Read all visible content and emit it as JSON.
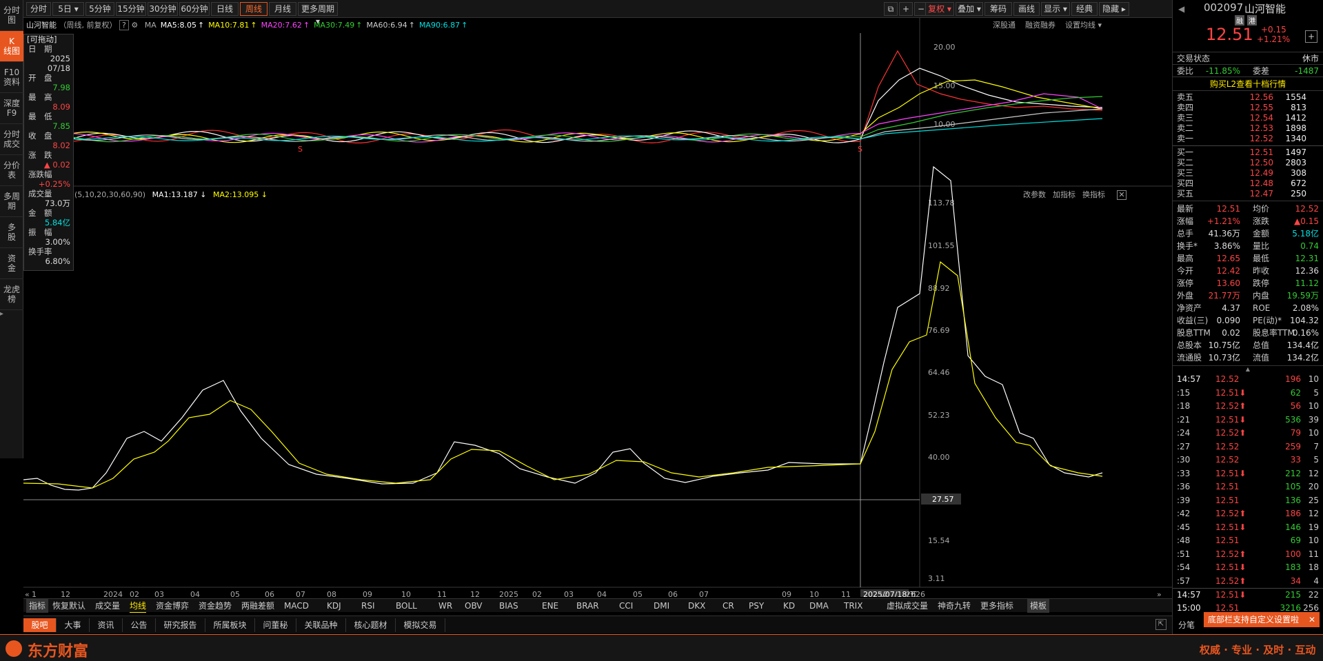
{
  "left_tabs": [
    {
      "l1": "分时",
      "l2": "图"
    },
    {
      "l1": "K",
      "l2": "线图"
    },
    {
      "l1": "F10",
      "l2": "资料"
    },
    {
      "l1": "深度",
      "l2": "F9"
    },
    {
      "l1": "分时",
      "l2": "成交"
    },
    {
      "l1": "分价",
      "l2": "表"
    },
    {
      "l1": "多周",
      "l2": "期"
    },
    {
      "l1": "多",
      "l2": "股"
    },
    {
      "l1": "资",
      "l2": "金"
    },
    {
      "l1": "龙虎",
      "l2": "榜"
    }
  ],
  "top_tabs": [
    "分时",
    "5日 ▾",
    "5分钟",
    "15分钟",
    "30分钟",
    "60分钟",
    "日线",
    "周线",
    "月线",
    "更多周期 ▾"
  ],
  "top_right": [
    "复权 ▾",
    "叠加 ▾",
    "筹码",
    "画线",
    "显示 ▾",
    "经典",
    "隐藏 ▸"
  ],
  "top_icons": [
    "⧉",
    "+",
    "−"
  ],
  "stock": {
    "name": "山河智能",
    "info": "（周线, 前复权）",
    "code": "002097",
    "title_name": "山河智能",
    "tag1": "融",
    "tag2": "港",
    "price": "12.51",
    "chg": "+0.15",
    "pct": "+1.21%"
  },
  "ma_legend": [
    {
      "label": "MA",
      "val": ""
    },
    {
      "label": "MA5:",
      "val": "8.05"
    },
    {
      "label": "MA10:",
      "val": "7.81"
    },
    {
      "label": "MA20:",
      "val": "7.62"
    },
    {
      "label": "MA30:",
      "val": "7.49"
    },
    {
      "label": "MA60:",
      "val": "6.94"
    },
    {
      "label": "MA90:",
      "val": "6.87"
    }
  ],
  "price_right_links": [
    "深股通",
    "融资融券",
    "设置均线 ▾"
  ],
  "price_axis": [
    "20.00",
    "15.00",
    "10.00"
  ],
  "ind_legend": {
    "params": "(5,10,20,30,60,90)",
    "ma1": "MA1:13.187",
    "ma2": "MA2:13.095"
  },
  "ind_links": [
    "改参数",
    "加指标",
    "换指标"
  ],
  "ind_axis": [
    "113.78",
    "101.55",
    "88.92",
    "76.69",
    "64.46",
    "52.23",
    "40.00",
    "27.57",
    "15.54",
    "3.11"
  ],
  "cursor_value": "27.57",
  "x_labels": [
    "12",
    "2024",
    "02",
    "03",
    "04",
    "05",
    "06",
    "07",
    "08",
    "09",
    "10",
    "11",
    "12",
    "2025",
    "02",
    "03",
    "04",
    "05",
    "06",
    "07",
    "2025/07/18/五",
    "09",
    "10",
    "11",
    "12",
    "2026"
  ],
  "x_first": "1",
  "data_panel": {
    "title": "[可拖动]",
    "rows": [
      {
        "k": "日　期",
        "v": "2025",
        "v2": "07/18",
        "cls": "w"
      },
      {
        "k": "开　盘",
        "v": "7.98",
        "cls": "g"
      },
      {
        "k": "最　高",
        "v": "8.09",
        "cls": "r"
      },
      {
        "k": "最　低",
        "v": "7.85",
        "cls": "g"
      },
      {
        "k": "收　盘",
        "v": "8.02",
        "cls": "r"
      },
      {
        "k": "涨　跌",
        "v": "▲ 0.02",
        "cls": "r"
      },
      {
        "k": "涨跌幅",
        "v": "+0.25%",
        "cls": "r"
      },
      {
        "k": "成交量",
        "v": "73.0万",
        "cls": "w"
      },
      {
        "k": "金　额",
        "v": "5.84亿",
        "cls": "c"
      },
      {
        "k": "振　幅",
        "v": "3.00%",
        "cls": "w"
      },
      {
        "k": "换手率",
        "v": "6.80%",
        "cls": "w"
      }
    ]
  },
  "trade_status": {
    "label": "交易状态",
    "value": "休市"
  },
  "weibi": {
    "l1": "委比",
    "v1": "-11.85%",
    "l2": "委差",
    "v2": "-1487"
  },
  "buy_l2": "购买L2查看十档行情",
  "sells": [
    {
      "k": "卖五",
      "p": "12.56",
      "v": "1554"
    },
    {
      "k": "卖四",
      "p": "12.55",
      "v": "813"
    },
    {
      "k": "卖三",
      "p": "12.54",
      "v": "1412"
    },
    {
      "k": "卖二",
      "p": "12.53",
      "v": "1898"
    },
    {
      "k": "卖一",
      "p": "12.52",
      "v": "1340"
    }
  ],
  "buys": [
    {
      "k": "买一",
      "p": "12.51",
      "v": "1497"
    },
    {
      "k": "买二",
      "p": "12.50",
      "v": "2803"
    },
    {
      "k": "买三",
      "p": "12.49",
      "v": "308"
    },
    {
      "k": "买四",
      "p": "12.48",
      "v": "672"
    },
    {
      "k": "买五",
      "p": "12.47",
      "v": "250"
    }
  ],
  "quote": [
    {
      "a": "最新",
      "b": "12.51",
      "bc": "r",
      "c": "均价",
      "d": "12.52",
      "dc": "r"
    },
    {
      "a": "涨幅",
      "b": "+1.21%",
      "bc": "r",
      "c": "涨跌",
      "d": "▲0.15",
      "dc": "r"
    },
    {
      "a": "总手",
      "b": "41.36万",
      "bc": "w",
      "c": "金额",
      "d": "5.18亿",
      "dc": "c"
    },
    {
      "a": "换手*",
      "b": "3.86%",
      "bc": "w",
      "c": "量比",
      "d": "0.74",
      "dc": "g"
    },
    {
      "a": "最高",
      "b": "12.65",
      "bc": "r",
      "c": "最低",
      "d": "12.31",
      "dc": "g"
    },
    {
      "a": "今开",
      "b": "12.42",
      "bc": "r",
      "c": "昨收",
      "d": "12.36",
      "dc": "w"
    },
    {
      "a": "涨停",
      "b": "13.60",
      "bc": "r",
      "c": "跌停",
      "d": "11.12",
      "dc": "g"
    },
    {
      "a": "外盘",
      "b": "21.77万",
      "bc": "r",
      "c": "内盘",
      "d": "19.59万",
      "dc": "g"
    },
    {
      "a": "净资产",
      "b": "4.37",
      "bc": "w",
      "c": "ROE",
      "d": "2.08%",
      "dc": "w"
    },
    {
      "a": "收益(三)",
      "b": "0.090",
      "bc": "w",
      "c": "PE(动)*",
      "d": "104.32",
      "dc": "w"
    },
    {
      "a": "股息TTM",
      "b": "0.02",
      "bc": "w",
      "c": "股息率TTM",
      "d": "0.16%",
      "dc": "w"
    },
    {
      "a": "总股本",
      "b": "10.75亿",
      "bc": "w",
      "c": "总值",
      "d": "134.4亿",
      "dc": "w"
    },
    {
      "a": "流通股",
      "b": "10.73亿",
      "bc": "w",
      "c": "流值",
      "d": "134.2亿",
      "dc": "w"
    }
  ],
  "ticks": [
    {
      "t": "14:57",
      "p": "12.52",
      "pc": "r",
      "v": "196",
      "vc": "r",
      "n": "10"
    },
    {
      "t": ":15",
      "p": "12.51⬇",
      "pc": "r",
      "v": "62",
      "vc": "g",
      "n": "5"
    },
    {
      "t": ":18",
      "p": "12.52⬆",
      "pc": "r",
      "v": "56",
      "vc": "r",
      "n": "10"
    },
    {
      "t": ":21",
      "p": "12.51⬇",
      "pc": "r",
      "v": "536",
      "vc": "g",
      "n": "39"
    },
    {
      "t": ":24",
      "p": "12.52⬆",
      "pc": "r",
      "v": "79",
      "vc": "r",
      "n": "10"
    },
    {
      "t": ":27",
      "p": "12.52",
      "pc": "r",
      "v": "259",
      "vc": "r",
      "n": "7"
    },
    {
      "t": ":30",
      "p": "12.52",
      "pc": "r",
      "v": "33",
      "vc": "r",
      "n": "5"
    },
    {
      "t": ":33",
      "p": "12.51⬇",
      "pc": "r",
      "v": "212",
      "vc": "g",
      "n": "12"
    },
    {
      "t": ":36",
      "p": "12.51",
      "pc": "r",
      "v": "105",
      "vc": "g",
      "n": "20"
    },
    {
      "t": ":39",
      "p": "12.51",
      "pc": "r",
      "v": "136",
      "vc": "g",
      "n": "25"
    },
    {
      "t": ":42",
      "p": "12.52⬆",
      "pc": "r",
      "v": "186",
      "vc": "r",
      "n": "12"
    },
    {
      "t": ":45",
      "p": "12.51⬇",
      "pc": "r",
      "v": "146",
      "vc": "g",
      "n": "19"
    },
    {
      "t": ":48",
      "p": "12.51",
      "pc": "r",
      "v": "69",
      "vc": "g",
      "n": "10"
    },
    {
      "t": ":51",
      "p": "12.52⬆",
      "pc": "r",
      "v": "100",
      "vc": "r",
      "n": "11"
    },
    {
      "t": ":54",
      "p": "12.51⬇",
      "pc": "r",
      "v": "183",
      "vc": "g",
      "n": "18"
    },
    {
      "t": ":57",
      "p": "12.52⬆",
      "pc": "r",
      "v": "34",
      "vc": "r",
      "n": "4"
    },
    {
      "t": "14:57",
      "p": "12.51⬇",
      "pc": "r",
      "v": "215",
      "vc": "g",
      "n": "22"
    },
    {
      "t": "15:00",
      "p": "12.51",
      "pc": "r",
      "v": "3216",
      "vc": "g",
      "n": "256"
    }
  ],
  "ind_tabs": [
    "指标",
    "恢复默认",
    "成交量",
    "均线",
    "资金博弈",
    "资金趋势",
    "两融差额",
    "MACD",
    "KDJ",
    "RSI",
    "BOLL",
    "WR",
    "OBV",
    "BIAS",
    "ENE",
    "BRAR",
    "CCI",
    "DMI",
    "DKX",
    "CR",
    "PSY",
    "KD",
    "DMA",
    "TRIX",
    "虚拟成交量",
    "神奇九转",
    "更多指标",
    "模板"
  ],
  "news_tabs": [
    "股吧",
    "大事",
    "资讯",
    "公告",
    "研究报告",
    "所属板块",
    "问董秘",
    "关联品种",
    "核心题材",
    "模拟交易"
  ],
  "rp_bottom_tab": "分笔",
  "toast": "底部栏支持自定义设置啦",
  "brand": "东方财富",
  "slogan": "权威 · 专业 · 及时 · 互动",
  "colors": {
    "accent": "#e8561f",
    "up": "#ff4444",
    "down": "#33cc33"
  }
}
